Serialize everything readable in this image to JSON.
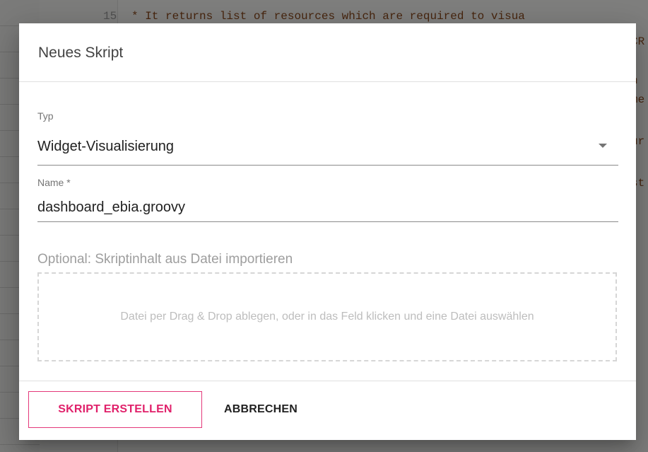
{
  "background_editor": {
    "visible_line_number": "15",
    "code_fragments": [
      "* It returns list of resources which are required to visua",
      "CR",
      "n",
      "me",
      "ur",
      "st"
    ]
  },
  "dialog": {
    "title": "Neues Skript",
    "type_field": {
      "label": "Typ",
      "value": "Widget-Visualisierung"
    },
    "name_field": {
      "label": "Name *",
      "value": "dashboard_ebia.groovy"
    },
    "import": {
      "label": "Optional: Skriptinhalt aus Datei importieren",
      "dropzone_text": "Datei per Drag & Drop ablegen, oder in das Feld klicken und eine Datei auswählen"
    },
    "actions": {
      "create_label": "SKRIPT ERSTELLEN",
      "cancel_label": "ABBRECHEN"
    }
  },
  "colors": {
    "accent": "#e0206a",
    "overlay": "rgba(0,0,0,0.48)"
  },
  "icons": {
    "type_dropdown": "dropdown-arrow-icon"
  }
}
